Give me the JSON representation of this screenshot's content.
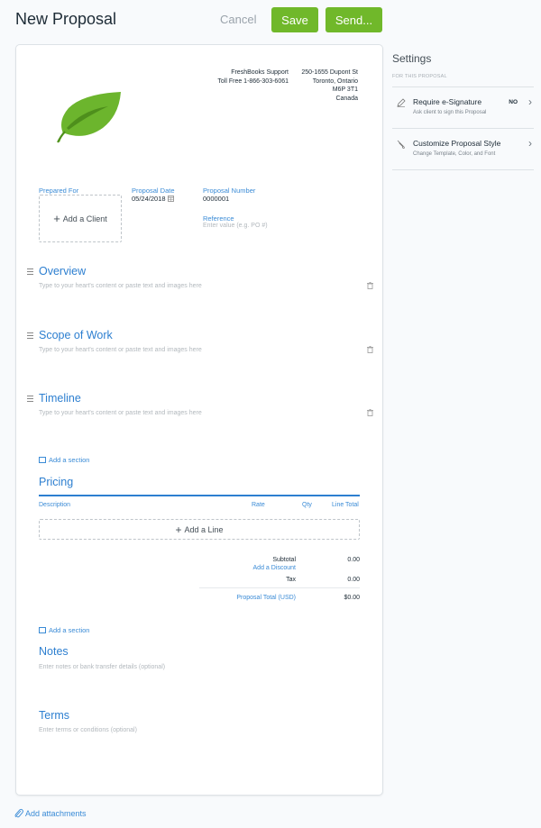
{
  "header": {
    "title": "New Proposal",
    "cancel_label": "Cancel",
    "save_label": "Save",
    "send_label": "Send..."
  },
  "colors": {
    "brand_green": "#70b82a",
    "link_blue": "#3a8bd6",
    "heading_blue": "#2d7fd0"
  },
  "company": {
    "name": "FreshBooks Support",
    "phone": "Toll Free 1-866-303-6061",
    "address_line1": "250-1655 Dupont St",
    "address_line2": "Toronto, Ontario",
    "postal": "M6P 3T1",
    "country": "Canada",
    "logo_icon": "leaf-icon"
  },
  "meta": {
    "prepared_for_label": "Prepared For",
    "add_client_label": "Add a Client",
    "proposal_date_label": "Proposal Date",
    "proposal_date_value": "05/24/2018",
    "proposal_number_label": "Proposal Number",
    "proposal_number_value": "0000001",
    "reference_label": "Reference",
    "reference_placeholder": "Enter value (e.g. PO #)"
  },
  "sections": [
    {
      "title": "Overview",
      "placeholder": "Type to your heart's content or paste text and images here"
    },
    {
      "title": "Scope of Work",
      "placeholder": "Type to your heart's content or paste text and images here"
    },
    {
      "title": "Timeline",
      "placeholder": "Type to your heart's content or paste text and images here"
    }
  ],
  "add_section_label": "Add a section",
  "pricing": {
    "title": "Pricing",
    "columns": [
      "Description",
      "Rate",
      "Qty",
      "Line Total"
    ],
    "add_line_label": "Add a Line",
    "subtotal_label": "Subtotal",
    "subtotal_value": "0.00",
    "add_discount_label": "Add a Discount",
    "tax_label": "Tax",
    "tax_value": "0.00",
    "total_label": "Proposal Total (USD)",
    "total_value": "$0.00"
  },
  "notes": {
    "title": "Notes",
    "placeholder": "Enter notes or bank transfer details (optional)"
  },
  "terms": {
    "title": "Terms",
    "placeholder": "Enter terms or conditions (optional)"
  },
  "attachments_label": "Add attachments",
  "settings": {
    "title": "Settings",
    "subtitle": "FOR THIS PROPOSAL",
    "items": [
      {
        "title": "Require e-Signature",
        "subtitle": "Ask client to sign this Proposal",
        "value": "NO",
        "icon": "pen-icon"
      },
      {
        "title": "Customize Proposal Style",
        "subtitle": "Change Template, Color, and Font",
        "icon": "brush-icon"
      }
    ]
  }
}
